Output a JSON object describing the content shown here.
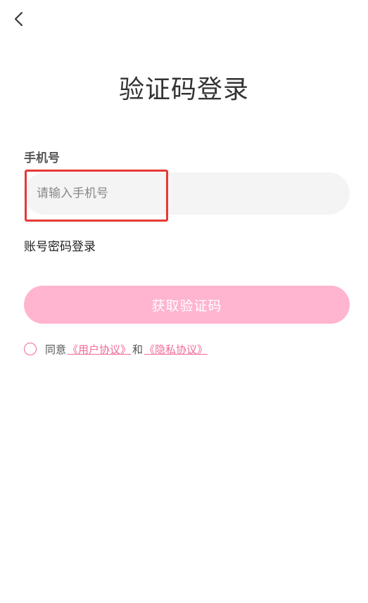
{
  "nav": {
    "back_icon": "chevron-left-icon"
  },
  "page": {
    "title": "验证码登录"
  },
  "form": {
    "phone_label": "手机号",
    "phone_placeholder": "请输入手机号",
    "phone_value": "",
    "alt_login_label": "账号密码登录",
    "submit_label": "获取验证码"
  },
  "agreement": {
    "prefix": "同意",
    "user_agreement": "《用户协议》",
    "conjunction": "和",
    "privacy_policy": "《隐私协议》",
    "checked": false
  },
  "colors": {
    "accent": "#f06a95",
    "button_disabled": "#ffb4cf",
    "input_bg": "#f4f4f4",
    "highlight": "#e53935"
  }
}
